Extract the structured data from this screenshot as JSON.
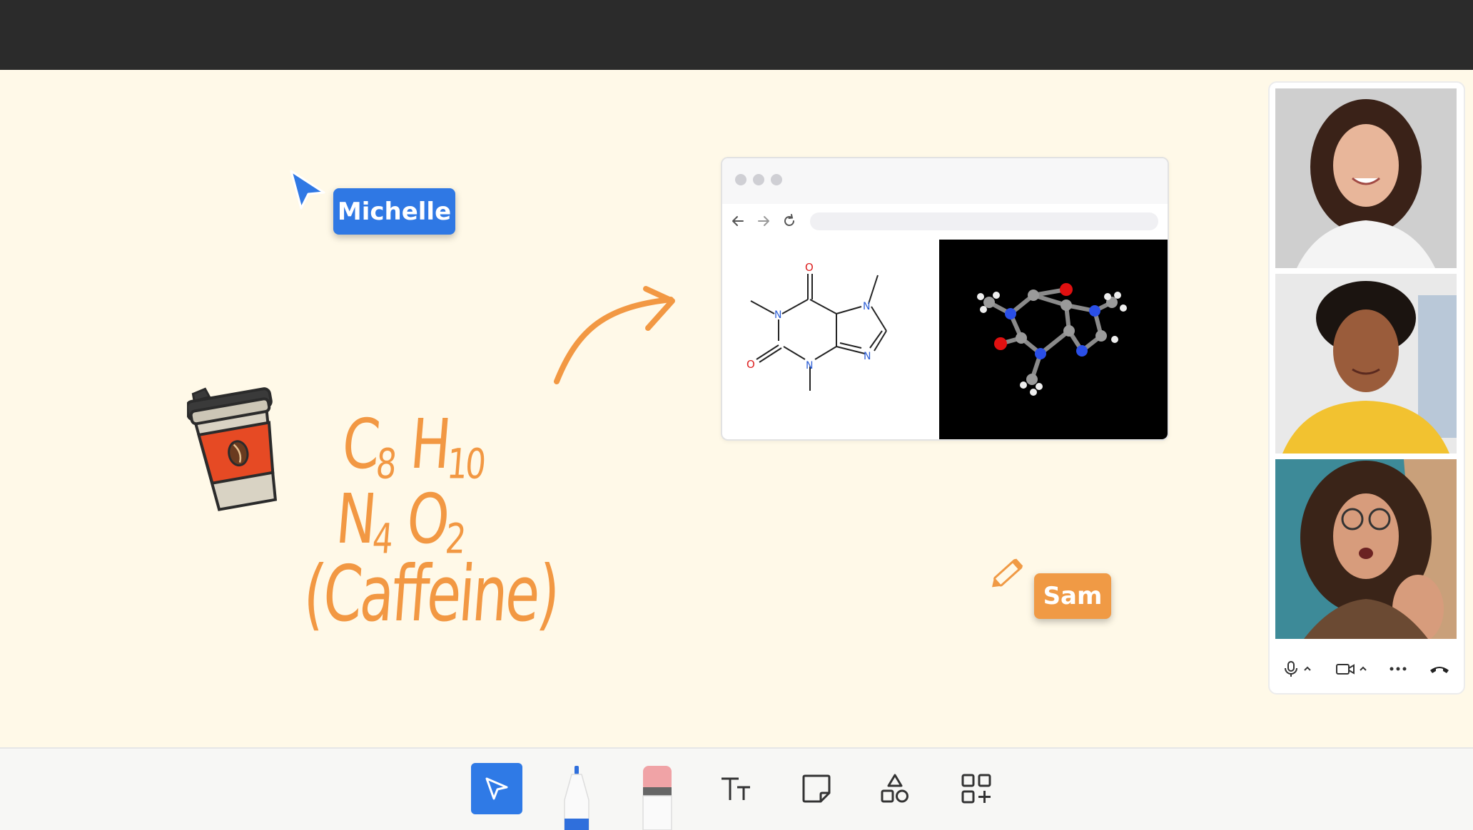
{
  "collaborators": {
    "michelle": {
      "name": "Michelle",
      "color": "#2f78e4"
    },
    "sam": {
      "name": "Sam",
      "color": "#f09a45"
    }
  },
  "whiteboard": {
    "formula": {
      "c": "C",
      "c_sub": "8",
      "h": "H",
      "h_sub": "10",
      "n": "N",
      "n_sub": "4",
      "o": "O",
      "o_sub": "2"
    },
    "caption": "(Caffeine)",
    "ink_color": "#f29843"
  },
  "embedded_browser": {
    "molecule_2d_atoms": {
      "n1": "N",
      "n2": "N",
      "n3": "N",
      "n4": "N",
      "o1": "O",
      "o2": "O"
    }
  },
  "video_call": {
    "participants": [
      {
        "name": "participant-1"
      },
      {
        "name": "participant-2"
      },
      {
        "name": "participant-3"
      }
    ],
    "controls": [
      "microphone",
      "camera",
      "more",
      "end-call"
    ]
  },
  "toolbar": {
    "tools": [
      "select",
      "pen",
      "eraser",
      "text",
      "sticky-note",
      "shapes",
      "add-apps"
    ],
    "active_tool": "select",
    "accent": "#2f7ae6"
  }
}
